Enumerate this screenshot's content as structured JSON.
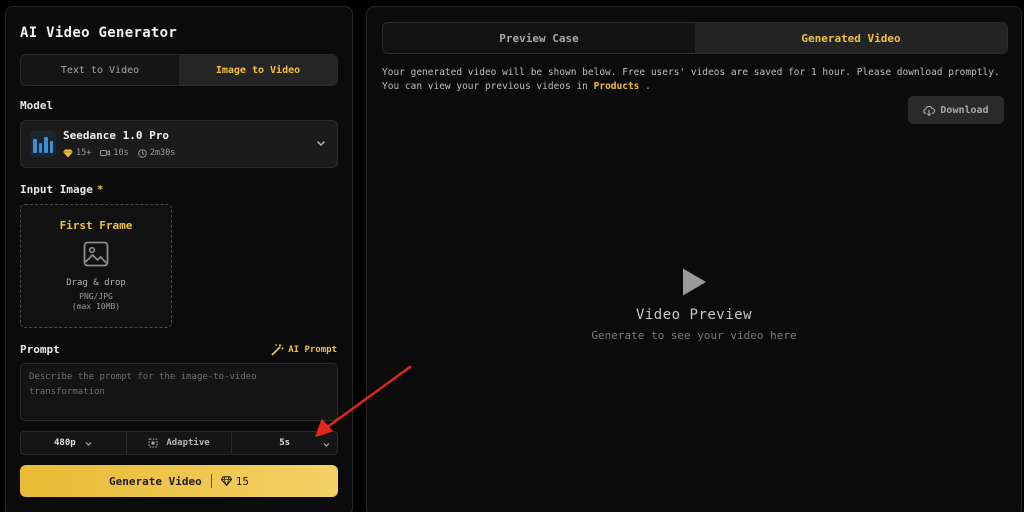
{
  "left": {
    "title": "AI Video Generator",
    "mode_tabs": [
      {
        "label": "Text to Video",
        "active": false
      },
      {
        "label": "Image to Video",
        "active": true
      }
    ],
    "model": {
      "section_label": "Model",
      "name": "Seedance 1.0 Pro",
      "credits": "15+",
      "duration": "10s",
      "time": "2m30s"
    },
    "input_image": {
      "label": "Input Image",
      "required_mark": "*",
      "box_title": "First Frame",
      "line1": "Drag & drop",
      "line2": "PNG/JPG",
      "line3": "(max 10MB)"
    },
    "prompt": {
      "label": "Prompt",
      "ai_prompt_label": "AI Prompt",
      "placeholder": "Describe the prompt for the image-to-video transformation"
    },
    "options": {
      "resolution": "480p",
      "aspect": "Adaptive",
      "duration": "5s"
    },
    "generate": {
      "label": "Generate Video",
      "cost": "15"
    }
  },
  "right": {
    "tabs": [
      {
        "label": "Preview Case",
        "active": false
      },
      {
        "label": "Generated Video",
        "active": true
      }
    ],
    "info_line1": "Your generated video will be shown below. Free users' videos are saved for 1 hour. Please download promptly.",
    "info_line2_prefix": "You can view your previous videos in",
    "info_link": "Products",
    "info_line2_suffix": ".",
    "download_label": "Download",
    "preview_title": "Video Preview",
    "preview_subtitle": "Generate to see your video here"
  },
  "colors": {
    "accent": "#f0c040",
    "annotation": "#e0281e"
  }
}
